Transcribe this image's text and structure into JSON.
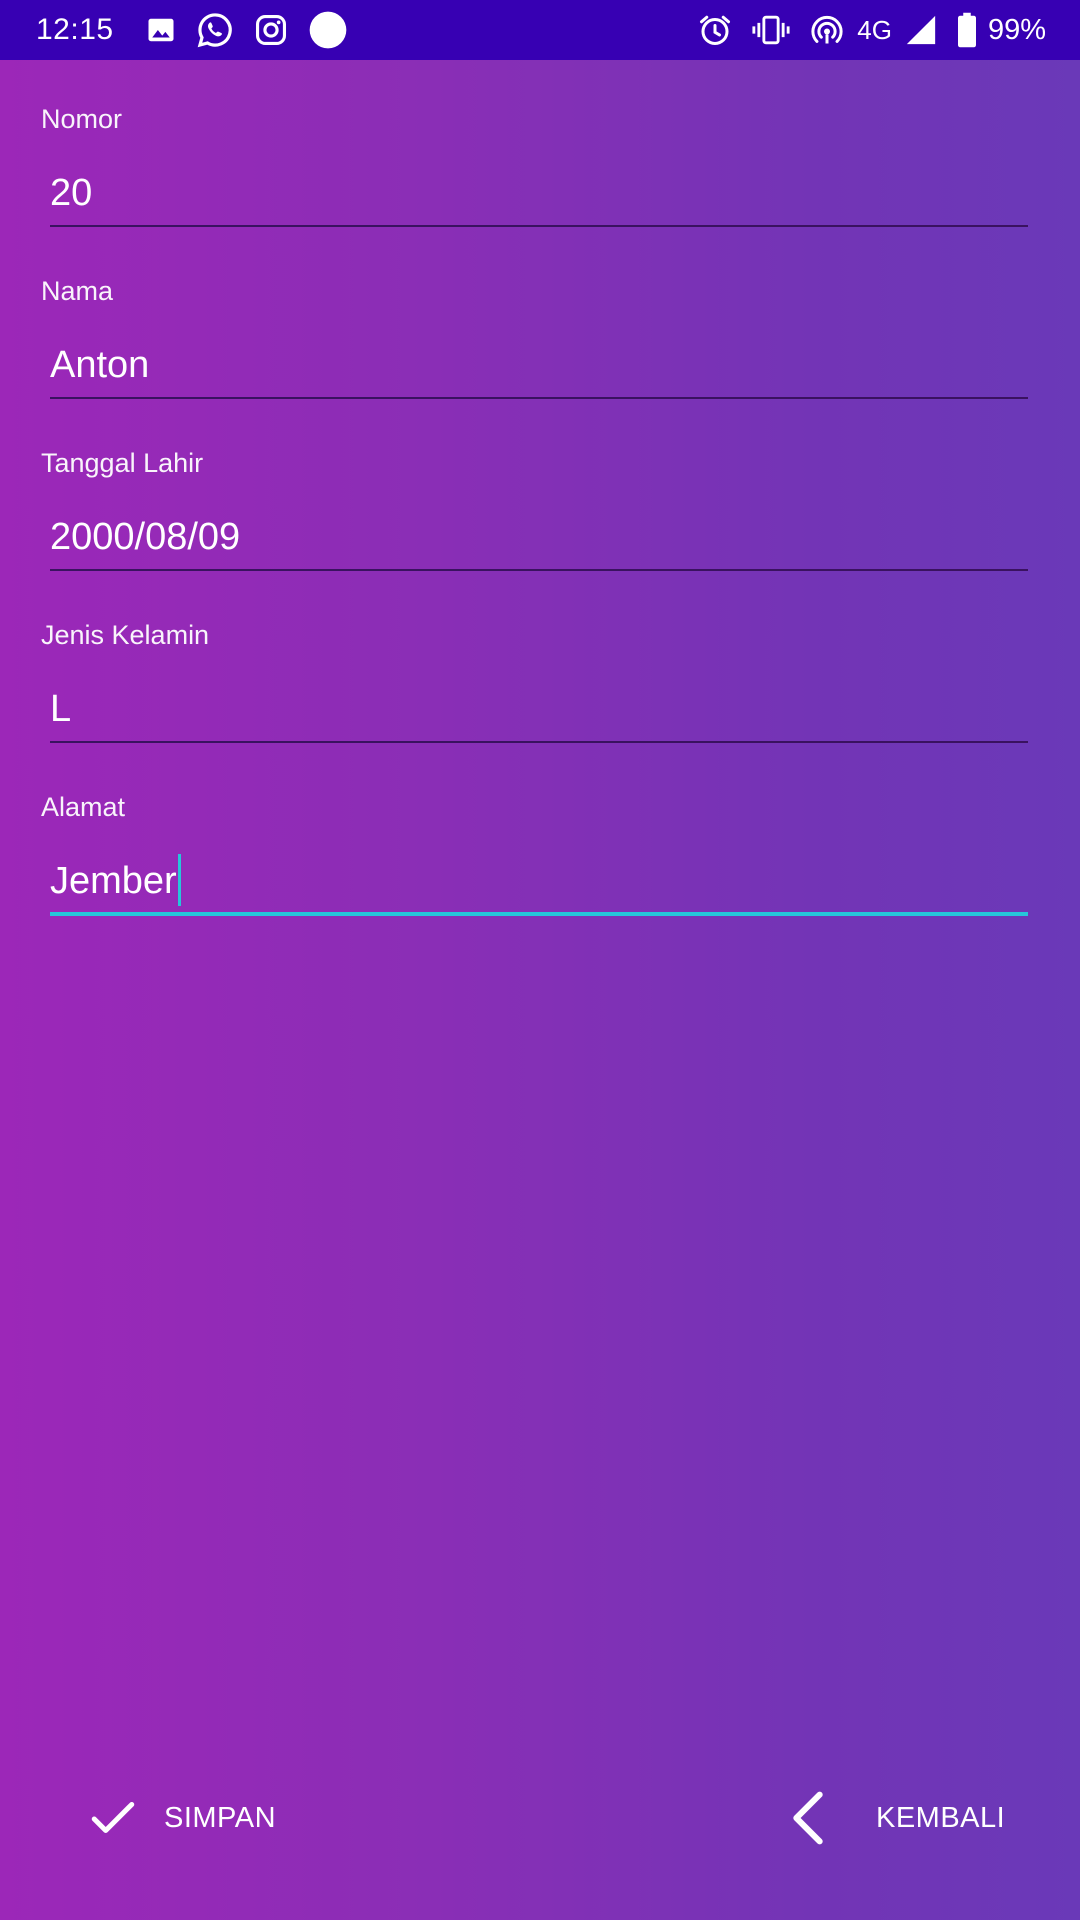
{
  "status_bar": {
    "time": "12:15",
    "network": "4G",
    "battery": "99%",
    "left_icons": [
      "gallery-icon",
      "whatsapp-icon",
      "instagram-icon",
      "circle-notification-icon"
    ],
    "right_icons": [
      "alarm-icon",
      "vibrate-icon",
      "hotspot-icon",
      "signal-icon",
      "battery-icon"
    ]
  },
  "form": {
    "fields": [
      {
        "label": "Nomor",
        "value": "20"
      },
      {
        "label": "Nama",
        "value": "Anton"
      },
      {
        "label": "Tanggal Lahir",
        "value": "2000/08/09"
      },
      {
        "label": "Jenis Kelamin",
        "value": "L"
      },
      {
        "label": "Alamat",
        "value": "Jember",
        "focused": true
      }
    ]
  },
  "actions": {
    "save_label": "SIMPAN",
    "save_icon": "check-icon",
    "back_label": "KEMBALI",
    "back_icon": "chevron-left-icon"
  },
  "colors": {
    "status_bar": "#3700b3",
    "gradient_start": "#9c27b8",
    "gradient_end": "#6a39b8",
    "focus_accent": "#26c6da",
    "underline": "#3a1260"
  }
}
